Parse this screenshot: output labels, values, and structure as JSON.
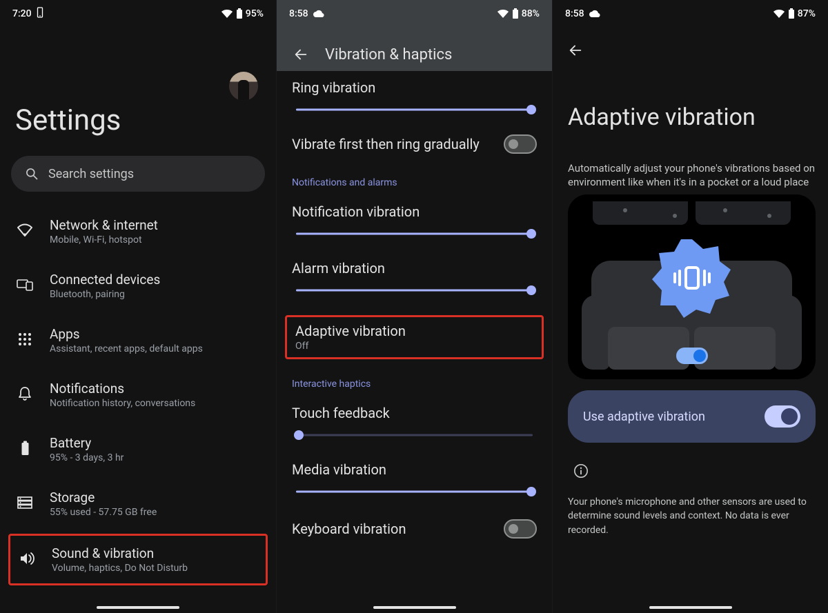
{
  "s1": {
    "status": {
      "time": "7:20",
      "battery": "95%"
    },
    "title": "Settings",
    "search": {
      "placeholder": "Search settings"
    },
    "items": [
      {
        "title": "Network & internet",
        "sub": "Mobile, Wi-Fi, hotspot"
      },
      {
        "title": "Connected devices",
        "sub": "Bluetooth, pairing"
      },
      {
        "title": "Apps",
        "sub": "Assistant, recent apps, default apps"
      },
      {
        "title": "Notifications",
        "sub": "Notification history, conversations"
      },
      {
        "title": "Battery",
        "sub": "95% - 3 days, 3 hr"
      },
      {
        "title": "Storage",
        "sub": "55% used - 57.75 GB free"
      },
      {
        "title": "Sound & vibration",
        "sub": "Volume, haptics, Do Not Disturb"
      }
    ]
  },
  "s2": {
    "status": {
      "time": "8:58",
      "battery": "88%"
    },
    "title": "Vibration & haptics",
    "rows": {
      "ring": "Ring vibration",
      "vibrateFirst": "Vibrate first then ring gradually",
      "notif": "Notification vibration",
      "alarm": "Alarm vibration",
      "adaptive": "Adaptive vibration",
      "adaptiveSub": "Off",
      "touch": "Touch feedback",
      "media": "Media vibration",
      "keyboard": "Keyboard vibration"
    },
    "sections": {
      "notifications": "Notifications and alarms",
      "interactive": "Interactive haptics"
    }
  },
  "s3": {
    "status": {
      "time": "8:58",
      "battery": "87%"
    },
    "title": "Adaptive vibration",
    "sub": "Automatically adjust your phone's vibrations based on environment like when it's in a pocket or a loud place",
    "card": "Use adaptive vibration",
    "note": "Your phone's microphone and other sensors are used to determine sound levels and context. No data is ever recorded."
  }
}
